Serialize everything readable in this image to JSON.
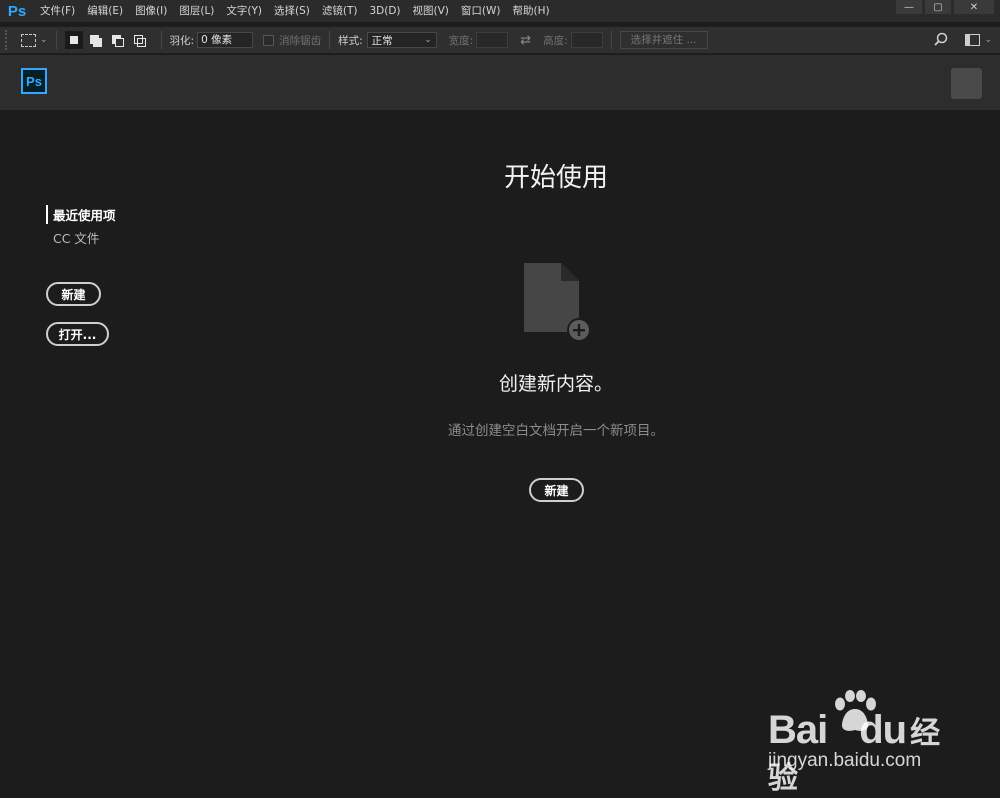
{
  "app": {
    "logo_text": "Ps"
  },
  "menu": [
    "文件(F)",
    "编辑(E)",
    "图像(I)",
    "图层(L)",
    "文字(Y)",
    "选择(S)",
    "滤镜(T)",
    "3D(D)",
    "视图(V)",
    "窗口(W)",
    "帮助(H)"
  ],
  "window_controls": {
    "minimize": "—",
    "maximize": "▢",
    "close": "✕"
  },
  "options_bar": {
    "feather_label": "羽化:",
    "feather_value": "0 像素",
    "antialias_label": "消除锯齿",
    "style_label": "样式:",
    "style_value": "正常",
    "width_label": "宽度:",
    "height_label": "高度:",
    "select_mask_label": "选择并遮住 ..."
  },
  "header": {
    "logo_text": "Ps"
  },
  "sidebar": {
    "items": [
      {
        "label": "最近使用项"
      },
      {
        "label": "CC 文件"
      }
    ],
    "new_button": "新建",
    "open_button": "打开..."
  },
  "main": {
    "title": "开始使用",
    "subtitle": "创建新内容。",
    "description": "通过创建空白文档开启一个新项目。",
    "new_button": "新建"
  },
  "watermark": {
    "brand": "Bai",
    "brand_tail": "du",
    "cn": "经验",
    "url": "jingyan.baidu.com"
  },
  "icons": [
    "marquee-icon",
    "search-icon",
    "workspace-icon",
    "new-file-icon",
    "swap-icon"
  ],
  "colors": {
    "accent": "#31a8ff",
    "background": "#1c1c1c",
    "header": "#2d2d2d"
  }
}
